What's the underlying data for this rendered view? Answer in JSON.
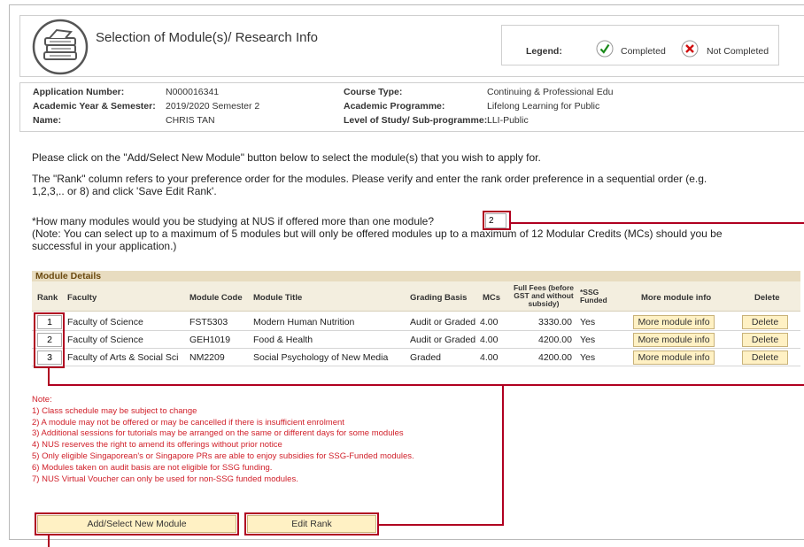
{
  "header": {
    "title": "Selection of Module(s)/ Research Info",
    "legend": {
      "label": "Legend:",
      "completed": "Completed",
      "not_completed": "Not Completed"
    }
  },
  "info": {
    "application_number_label": "Application Number:",
    "application_number": "N000016341",
    "academic_year_label": "Academic Year & Semester:",
    "academic_year": "2019/2020 Semester 2",
    "name_label": "Name:",
    "name": "CHRIS TAN",
    "course_type_label": "Course Type:",
    "course_type": "Continuing & Professional Edu",
    "programme_label": "Academic Programme:",
    "programme": "Lifelong Learning for Public",
    "level_label": "Level of Study/ Sub-programme:",
    "level": "LLI-Public"
  },
  "instructions": {
    "p1": "Please click on the \"Add/Select New Module\" button below to select the module(s) that you wish to apply for.",
    "p2a": "The \"Rank\" column refers to your preference order for the modules. Please verify and enter the rank order preference in a sequential order (e.g.",
    "p2b": "1,2,3,.. or 8) and click 'Save Edit Rank'.",
    "q": "*How many modules would you be studying at NUS if offered more than one module?",
    "q_value": "2",
    "note_a": "(Note: You can select up to a maximum of 5 modules but will only be offered modules up to a maximum of 12 Modular Credits (MCs) should you be",
    "note_b": "successful in your application.)"
  },
  "module_table": {
    "caption": "Module Details",
    "headers": {
      "rank": "Rank",
      "faculty": "Faculty",
      "code": "Module Code",
      "title": "Module Title",
      "grading": "Grading Basis",
      "mcs": "MCs",
      "fees_1": "Full Fees (before",
      "fees_2": "GST and without",
      "fees_3": "subsidy)",
      "ssg_1": "*SSG",
      "ssg_2": "Funded",
      "more": "More module info",
      "delete": "Delete"
    },
    "rows": [
      {
        "rank": "1",
        "faculty": "Faculty of Science",
        "code": "FST5303",
        "title": "Modern Human Nutrition",
        "grading": "Audit or Graded",
        "mcs": "4.00",
        "fees": "3330.00",
        "ssg": "Yes",
        "more": "More module info",
        "delete": "Delete"
      },
      {
        "rank": "2",
        "faculty": "Faculty of Science",
        "code": "GEH1019",
        "title": "Food & Health",
        "grading": "Audit or Graded",
        "mcs": "4.00",
        "fees": "4200.00",
        "ssg": "Yes",
        "more": "More module info",
        "delete": "Delete"
      },
      {
        "rank": "3",
        "faculty": "Faculty of Arts & Social Sci",
        "code": "NM2209",
        "title": "Social Psychology of New Media",
        "grading": "Graded",
        "mcs": "4.00",
        "fees": "4200.00",
        "ssg": "Yes",
        "more": "More module info",
        "delete": "Delete"
      }
    ]
  },
  "notes": [
    "Note:",
    "1) Class schedule may be subject to change",
    "2) A module may not be offered or may be cancelled if there is insufficient enrolment",
    "3) Additional sessions for tutorials may be arranged on the same or different days for some modules",
    "4) NUS reserves the right to amend its offerings without prior notice",
    "5) Only eligible Singaporean's or Singapore PRs are able to enjoy subsidies for SSG-Funded modules.",
    "6) Modules taken on audit basis are not eligible for SSG funding.",
    "7) NUS Virtual Voucher can only be used for non-SSG funded modules."
  ],
  "buttons": {
    "add": "Add/Select New Module",
    "edit_rank": "Edit Rank"
  },
  "colors": {
    "highlight": "#b00020",
    "button_bg": "#fff1c4",
    "note_text": "#d0202a"
  },
  "icons": {
    "logo": "books-icon",
    "completed": "check-icon",
    "not_completed": "x-icon"
  }
}
